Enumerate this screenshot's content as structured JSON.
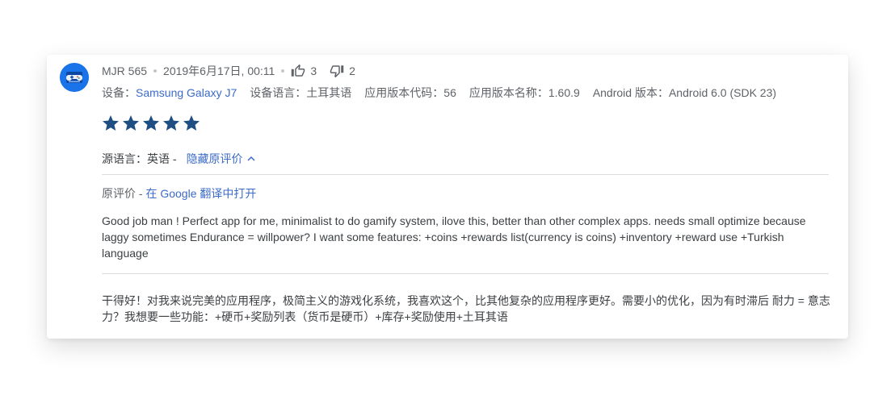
{
  "review": {
    "author": "MJR 565",
    "date": "2019年6月17日, 00:11",
    "thumbs_up_count": "3",
    "thumbs_down_count": "2",
    "rating": 5,
    "rating_max": 5,
    "device": {
      "device_label": "设备：",
      "device_value": "Samsung Galaxy J7",
      "language_label": "设备语言：",
      "language_value": "土耳其语",
      "version_code_label": "应用版本代码：",
      "version_code_value": "56",
      "version_name_label": "应用版本名称：",
      "version_name_value": "1.60.9",
      "android_label": "Android 版本：",
      "android_value": "Android 6.0 (SDK 23)"
    },
    "source_language_label": "源语言：",
    "source_language_value": "英语 -",
    "hide_original_label": "隐藏原评价",
    "original_label": "原评价 -",
    "open_in_google_translate": "在 Google 翻译中打开",
    "original_text": "Good job man ! Perfect app for me, minimalist to do gamify system, ilove this, better than other complex apps. needs small optimize because laggy sometimes Endurance = willpower? I want some features: +coins +rewards list(currency is coins) +inventory +reward use +Turkish language",
    "translated_text": "干得好！对我来说完美的应用程序，极简主义的游戏化系统，我喜欢这个，比其他复杂的应用程序更好。需要小的优化，因为有时滞后 耐力 = 意志力？我想要一些功能：+硬币+奖励列表（货币是硬币）+库存+奖励使用+土耳其语"
  },
  "colors": {
    "star": "#1f4f82",
    "link": "#3c6bc9",
    "avatar_bg": "#1a73e8"
  },
  "icons": {
    "avatar": "gamepad-avatar-icon",
    "thumbs_up": "thumbs-up-icon",
    "thumbs_down": "thumbs-down-icon",
    "star": "star-icon",
    "collapse": "chevron-up-icon"
  }
}
